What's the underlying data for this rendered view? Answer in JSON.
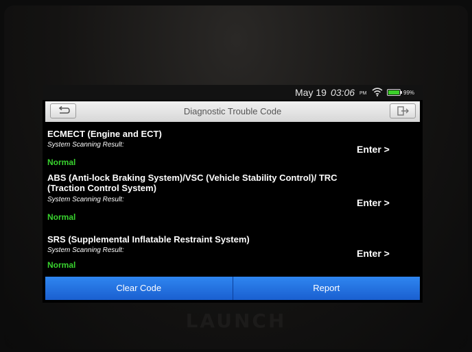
{
  "device": {
    "brand": "LAUNCH"
  },
  "status_bar": {
    "date": "May 19",
    "time": "03:06",
    "ampm": "PM",
    "battery": "99%"
  },
  "header": {
    "title": "Diagnostic Trouble Code",
    "back_icon": "back-arrow-icon",
    "exit_icon": "exit-icon"
  },
  "systems": [
    {
      "name": "ECMECT (Engine and ECT)",
      "result_label": "System Scanning Result:",
      "result": "Normal",
      "action": "Enter >"
    },
    {
      "name": "ABS (Anti-lock Braking System)/VSC (Vehicle Stability Control)/ TRC (Traction Control System)",
      "result_label": "System Scanning Result:",
      "result": "Normal",
      "action": "Enter >"
    },
    {
      "name": "SRS (Supplemental Inflatable Restraint System)",
      "result_label": "System Scanning Result:",
      "result": "Normal",
      "action": "Enter >"
    }
  ],
  "footer": {
    "clear_code": "Clear Code",
    "report": "Report"
  },
  "colors": {
    "accent_blue": "#1f6fe3",
    "status_green": "#38d22e"
  }
}
